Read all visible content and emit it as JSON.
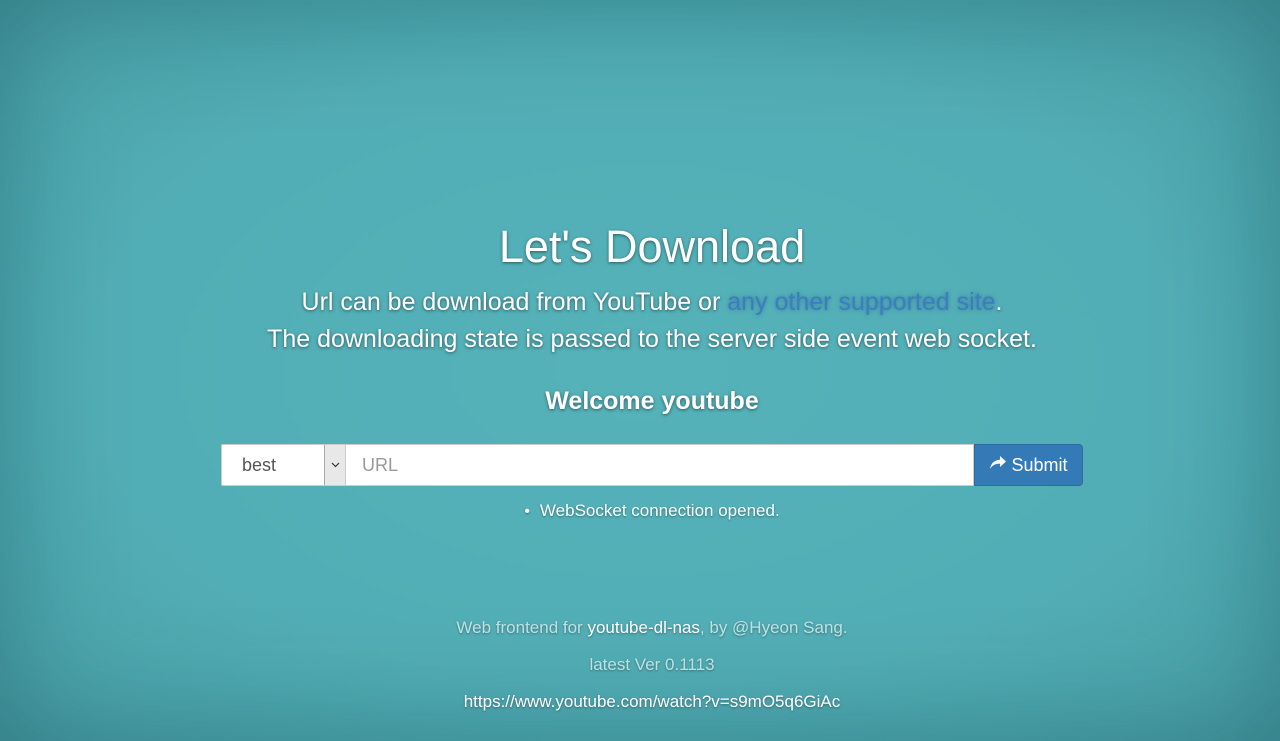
{
  "header": {
    "title": "Let's Download"
  },
  "lead": {
    "line1_prefix": "Url can be download from YouTube or ",
    "supported_link": "any other supported site",
    "line1_suffix": ".",
    "line2": "The downloading state is passed to the server side event web socket."
  },
  "welcome": "Welcome youtube",
  "form": {
    "format_selected": "best",
    "url_value": "",
    "url_placeholder": "URL",
    "submit_label": "Submit",
    "submit_icon": "share-arrow-icon",
    "select_icon": "chevron-down-icon"
  },
  "status": {
    "messages": [
      "WebSocket connection opened."
    ]
  },
  "footer": {
    "prefix": "Web frontend for ",
    "project_link": "youtube-dl-nas",
    "suffix": ", by @Hyeon Sang.",
    "version": "latest Ver 0.1113",
    "example_url": "https://www.youtube.com/watch?v=s9mO5q6GiAc"
  },
  "colors": {
    "background": "#52aeb6",
    "primary": "#337ab7",
    "link": "#3a7ec0"
  }
}
